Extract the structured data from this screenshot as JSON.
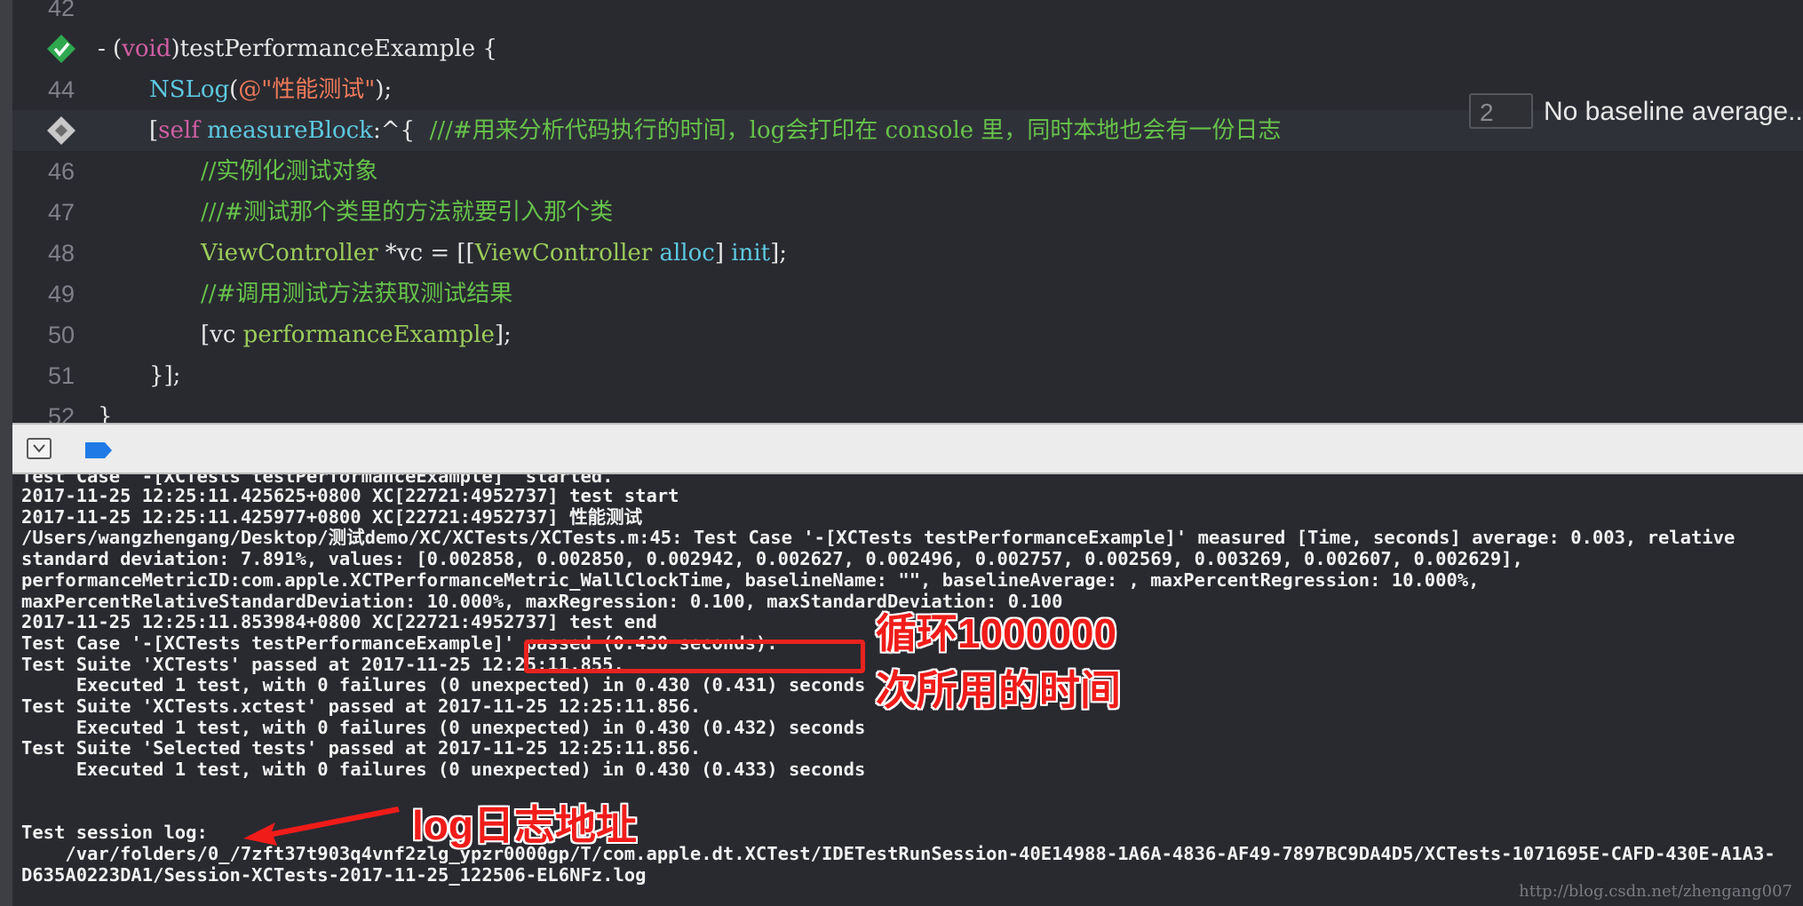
{
  "editor": {
    "lines": [
      {
        "number": "42",
        "segments": []
      },
      {
        "number": "",
        "segments": [
          {
            "cls": "plain",
            "text": "- ("
          },
          {
            "cls": "kw",
            "text": "void"
          },
          {
            "cls": "plain",
            "text": ")testPerformanceExample {"
          }
        ]
      },
      {
        "number": "44",
        "segments": [
          {
            "cls": "cls",
            "text": "NSLog"
          },
          {
            "cls": "plain",
            "text": "("
          },
          {
            "cls": "str",
            "text": "@\"性能测试\""
          },
          {
            "cls": "plain",
            "text": ");"
          }
        ]
      },
      {
        "number": "",
        "segments": [
          {
            "cls": "plain",
            "text": "["
          },
          {
            "cls": "kw",
            "text": "self"
          },
          {
            "cls": "plain",
            "text": " "
          },
          {
            "cls": "cls",
            "text": "measureBlock"
          },
          {
            "cls": "plain",
            "text": ":^{  "
          },
          {
            "cls": "cmt",
            "text": "///#用来分析代码执行的时间，log会打印在 console 里，同时本地也会有一份日志"
          }
        ]
      },
      {
        "number": "46",
        "segments": [
          {
            "cls": "cmt",
            "text": "//实例化测试对象"
          }
        ]
      },
      {
        "number": "47",
        "segments": [
          {
            "cls": "cmt",
            "text": "///#测试那个类里的方法就要引入那个类"
          }
        ]
      },
      {
        "number": "48",
        "segments": [
          {
            "cls": "meth",
            "text": "ViewController"
          },
          {
            "cls": "plain",
            "text": " *vc = [["
          },
          {
            "cls": "meth",
            "text": "ViewController"
          },
          {
            "cls": "plain",
            "text": " "
          },
          {
            "cls": "cls",
            "text": "alloc"
          },
          {
            "cls": "plain",
            "text": "] "
          },
          {
            "cls": "cls",
            "text": "init"
          },
          {
            "cls": "plain",
            "text": "];"
          }
        ]
      },
      {
        "number": "49",
        "segments": [
          {
            "cls": "cmt",
            "text": "//#调用测试方法获取测试结果"
          }
        ]
      },
      {
        "number": "50",
        "segments": [
          {
            "cls": "plain",
            "text": "[vc "
          },
          {
            "cls": "meth",
            "text": "performanceExample"
          },
          {
            "cls": "plain",
            "text": "];"
          }
        ]
      },
      {
        "number": "51",
        "segments": [
          {
            "cls": "plain",
            "text": "}];"
          }
        ]
      },
      {
        "number": "52",
        "segments": [
          {
            "cls": "plain",
            "text": "}"
          }
        ]
      }
    ],
    "baseline": {
      "value": "2",
      "label": "No baseline average..."
    }
  },
  "debug_bar": {
    "toggle_icon": "hide-console-icon",
    "breakpoint_icon": "breakpoint-toggle-icon",
    "breakpoint_color": "#1f7ae6"
  },
  "console": {
    "partial_line": "Test Case '-[XCTests testPerformanceExample]' started.",
    "lines": [
      "2017-11-25 12:25:11.425625+0800 XC[22721:4952737] test start",
      "2017-11-25 12:25:11.425977+0800 XC[22721:4952737] 性能测试",
      "/Users/wangzhengang/Desktop/测试demo/XC/XCTests/XCTests.m:45: Test Case '-[XCTests testPerformanceExample]' measured [Time, seconds] average: 0.003, relative",
      "standard deviation: 7.891%, values: [0.002858, 0.002850, 0.002942, 0.002627, 0.002496, 0.002757, 0.002569, 0.003269, 0.002607, 0.002629],",
      "performanceMetricID:com.apple.XCTPerformanceMetric_WallClockTime, baselineName: \"\", baselineAverage: , maxPercentRegression: 10.000%,",
      "maxPercentRelativeStandardDeviation: 10.000%, maxRegression: 0.100, maxStandardDeviation: 0.100",
      "2017-11-25 12:25:11.853984+0800 XC[22721:4952737] test end",
      "Test Case '-[XCTests testPerformanceExample]' passed (0.430 seconds).",
      "Test Suite 'XCTests' passed at 2017-11-25 12:25:11.855.",
      "     Executed 1 test, with 0 failures (0 unexpected) in 0.430 (0.431) seconds",
      "Test Suite 'XCTests.xctest' passed at 2017-11-25 12:25:11.856.",
      "     Executed 1 test, with 0 failures (0 unexpected) in 0.430 (0.432) seconds",
      "Test Suite 'Selected tests' passed at 2017-11-25 12:25:11.856.",
      "     Executed 1 test, with 0 failures (0 unexpected) in 0.430 (0.433) seconds",
      "",
      "",
      "Test session log:",
      "    /var/folders/0_/7zft37t903q4vnf2zlg_ypzr0000gp/T/com.apple.dt.XCTest/IDETestRunSession-40E14988-1A6A-4836-AF49-7897BC9DA4D5/XCTests-1071695E-CAFD-430E-A1A3-",
      "D635A0223DA1/Session-XCTests-2017-11-25_122506-EL6NFz.log"
    ]
  },
  "annotations": {
    "loop_line1": "循环1000000",
    "loop_line2": "次所用的时间",
    "log_address": "log日志地址",
    "color": "#f01c19"
  },
  "watermark": "http://blog.csdn.net/zhengang007"
}
